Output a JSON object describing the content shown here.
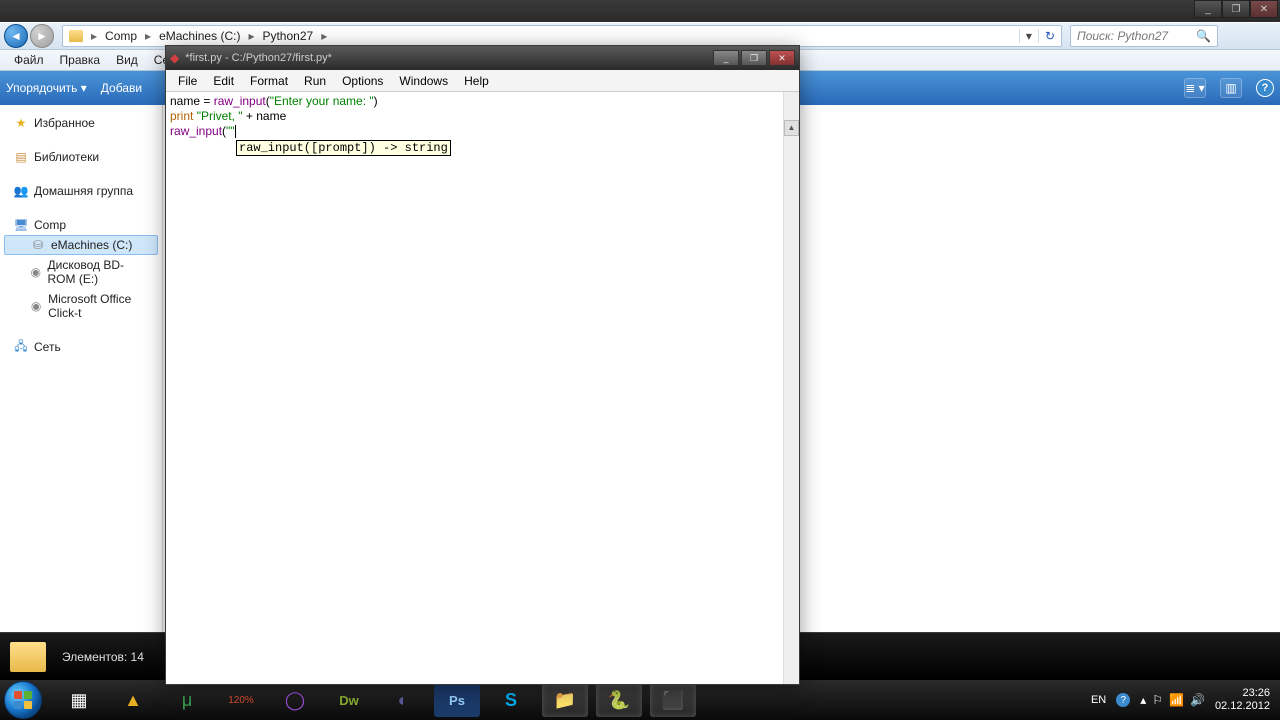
{
  "outer_window": {
    "min": "_",
    "max": "❐",
    "close": "✕"
  },
  "breadcrumb": {
    "segments": [
      "Comp",
      "eMachines (C:)",
      "Python27"
    ],
    "separator": "▸"
  },
  "search": {
    "placeholder": "Поиск: Python27"
  },
  "explorer_menu": [
    "Файл",
    "Правка",
    "Вид",
    "Се"
  ],
  "cmdbar": {
    "organize": "Упорядочить ▾",
    "add": "Добави"
  },
  "nav": {
    "favorites": "Избранное",
    "libraries": "Библиотеки",
    "homegroup": "Домашняя группа",
    "computer": "Comp",
    "drive_c": "eMachines (C:)",
    "drive_bd": "Дисковод BD-ROM (E:)",
    "drive_ms": "Microsoft Office Click-t",
    "network": "Сеть"
  },
  "status": {
    "count_label": "Элементов: 14"
  },
  "idle": {
    "title": "*first.py - C:/Python27/first.py*",
    "menu": [
      "File",
      "Edit",
      "Format",
      "Run",
      "Options",
      "Windows",
      "Help"
    ],
    "code_l1a": "name = ",
    "code_l1b": "raw_input",
    "code_l1c": "(",
    "code_l1d": "\"Enter your name: \"",
    "code_l1e": ")",
    "code_l2a": "print",
    "code_l2b": " ",
    "code_l2c": "\"Privet, \"",
    "code_l2d": " + name",
    "code_l3a": "raw_input",
    "code_l3b": "(",
    "code_l3c": "\"\"",
    "tooltip": "raw_input([prompt]) -> string"
  },
  "taskbar": {
    "lang": "EN",
    "time": "23:26",
    "date": "02.12.2012"
  }
}
